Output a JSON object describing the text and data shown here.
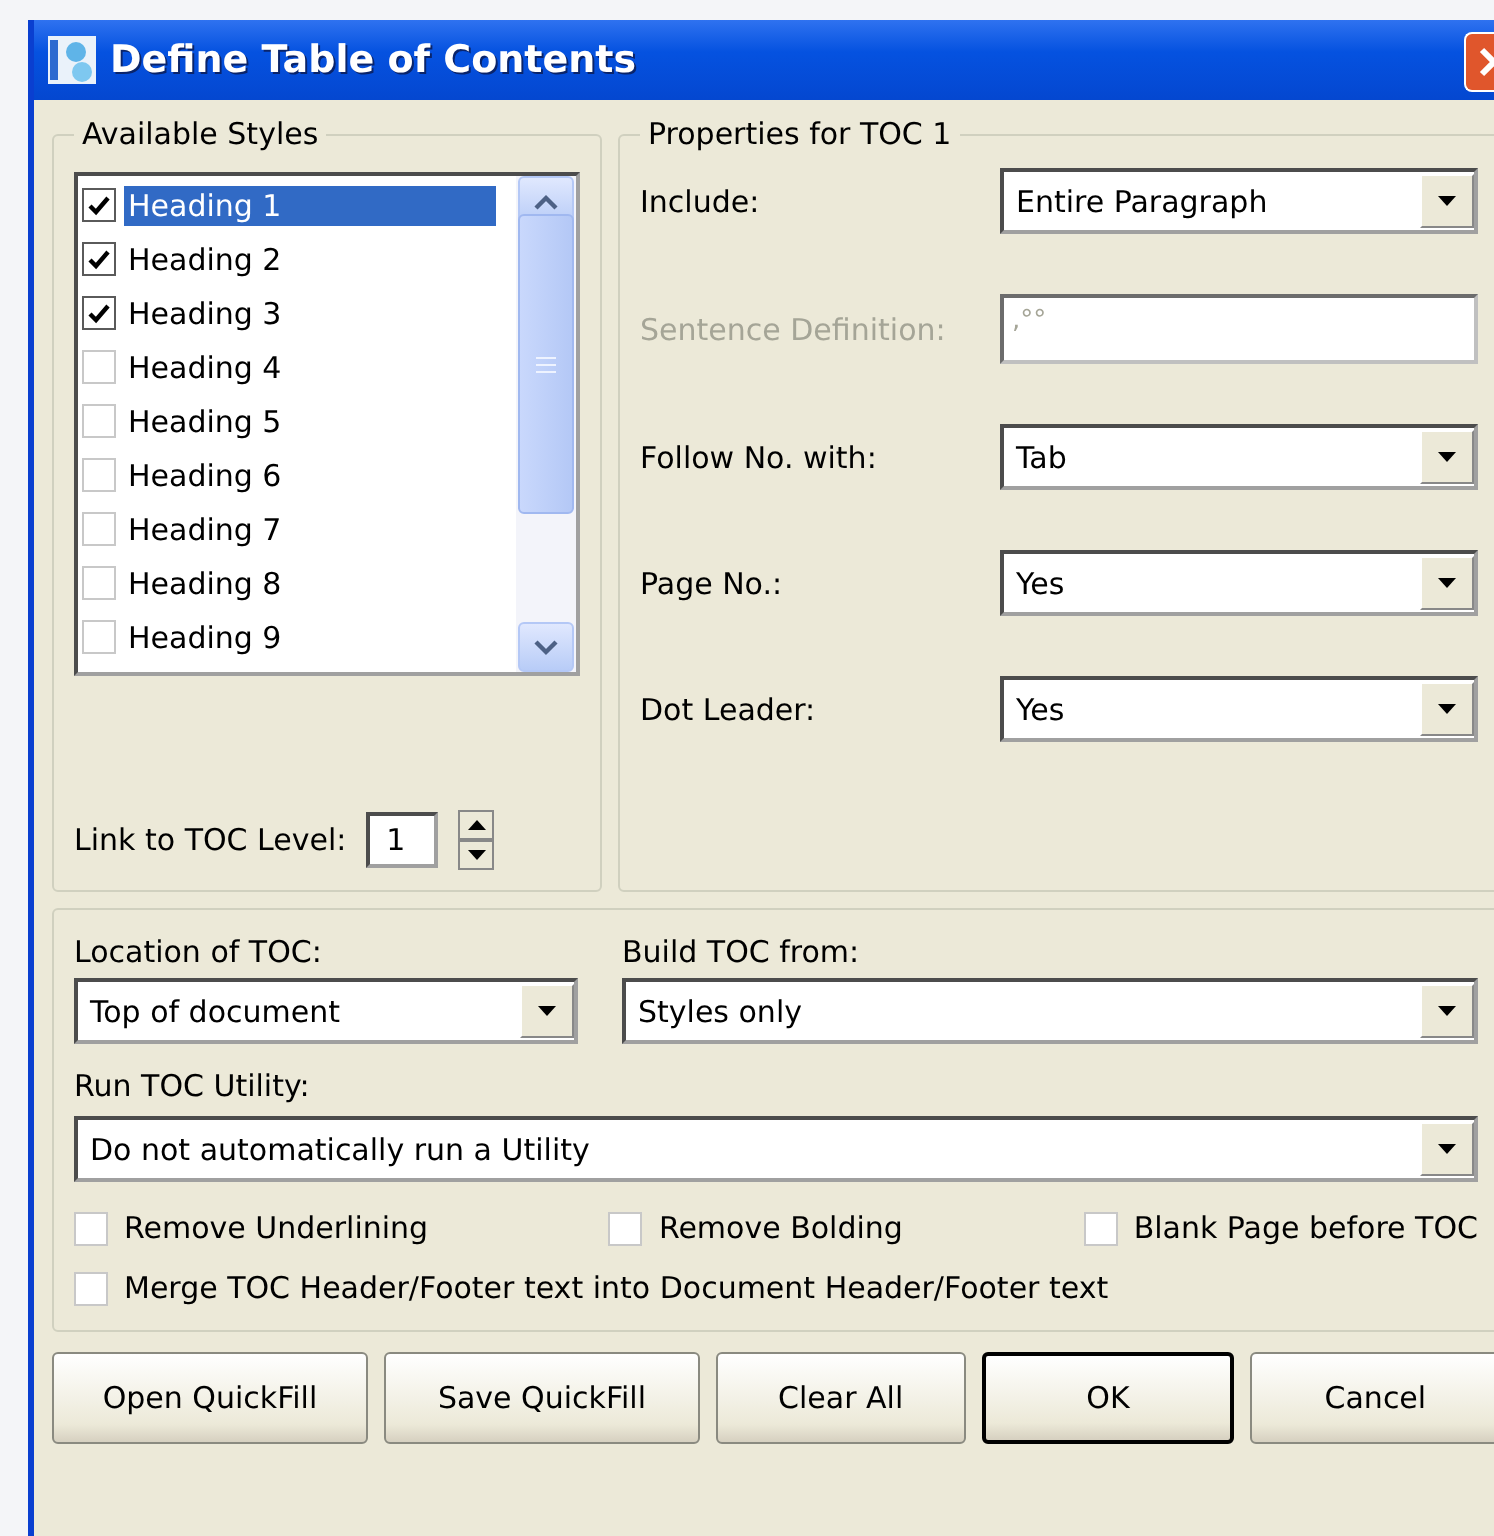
{
  "window": {
    "title": "Define Table of Contents"
  },
  "available_styles": {
    "title": "Available Styles",
    "items": [
      {
        "label": "Heading 1",
        "checked": true,
        "selected": true
      },
      {
        "label": "Heading 2",
        "checked": true,
        "selected": false
      },
      {
        "label": "Heading 3",
        "checked": true,
        "selected": false
      },
      {
        "label": "Heading 4",
        "checked": false,
        "selected": false
      },
      {
        "label": "Heading 5",
        "checked": false,
        "selected": false
      },
      {
        "label": "Heading 6",
        "checked": false,
        "selected": false
      },
      {
        "label": "Heading 7",
        "checked": false,
        "selected": false
      },
      {
        "label": "Heading 8",
        "checked": false,
        "selected": false
      },
      {
        "label": "Heading 9",
        "checked": false,
        "selected": false
      }
    ],
    "link_level": {
      "label": "Link to TOC Level:",
      "value": "1"
    }
  },
  "properties": {
    "title": "Properties for TOC 1",
    "rows": [
      {
        "label": "Include:",
        "value": "Entire Paragraph",
        "kind": "dropdown",
        "disabled": false
      },
      {
        "label": "Sentence Definition:",
        "value": ",°°",
        "kind": "field",
        "disabled": true
      },
      {
        "label": "Follow No. with:",
        "value": "Tab",
        "kind": "dropdown",
        "disabled": false
      },
      {
        "label": "Page No.:",
        "value": "Yes",
        "kind": "dropdown",
        "disabled": false
      },
      {
        "label": "Dot Leader:",
        "value": "Yes",
        "kind": "dropdown",
        "disabled": false
      }
    ]
  },
  "location": {
    "label": "Location of TOC:",
    "value": "Top of document"
  },
  "build_from": {
    "label": "Build TOC from:",
    "value": "Styles only"
  },
  "run_utility": {
    "label": "Run TOC Utility:",
    "value": "Do not automatically run a Utility"
  },
  "options": [
    {
      "label": "Remove Underlining",
      "checked": false
    },
    {
      "label": "Remove Bolding",
      "checked": false
    },
    {
      "label": "Blank Page before TOC",
      "checked": false
    },
    {
      "label": "Merge TOC Header/Footer text into Document Header/Footer text",
      "checked": false
    }
  ],
  "buttons": [
    {
      "label": "Open QuickFill",
      "default": false
    },
    {
      "label": "Save QuickFill",
      "default": false
    },
    {
      "label": "Clear All",
      "default": false
    },
    {
      "label": "OK",
      "default": true
    },
    {
      "label": "Cancel",
      "default": false
    }
  ]
}
